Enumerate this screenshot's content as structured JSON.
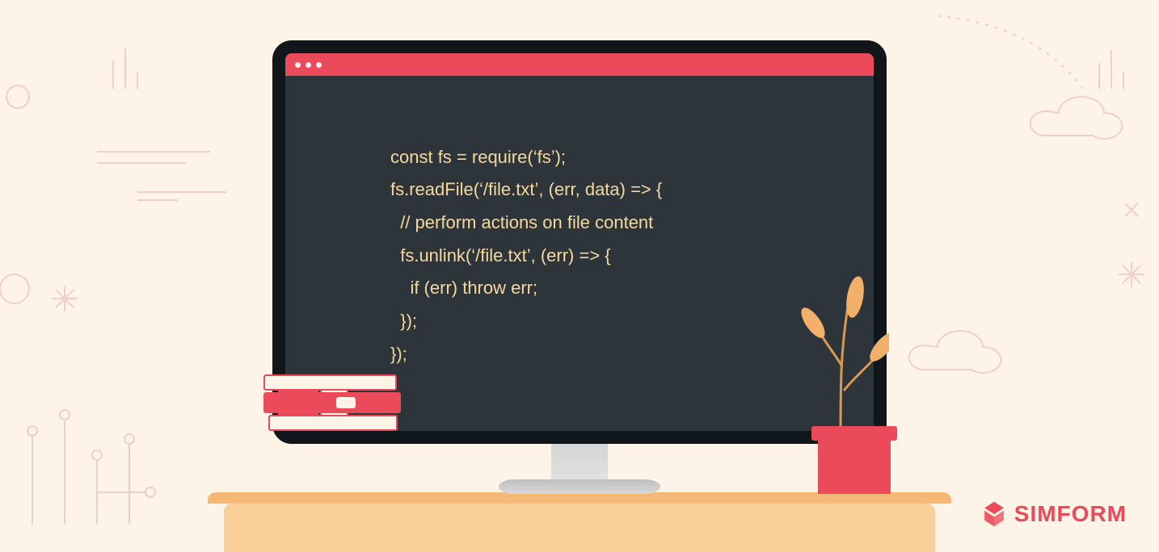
{
  "code": {
    "lines": [
      "const fs = require(‘fs’);",
      "fs.readFile(‘/file.txt’, (err, data) => {",
      "  // perform actions on file content",
      "  fs.unlink(‘/file.txt’, (err) => {",
      "    if (err) throw err;",
      "  });",
      "});"
    ]
  },
  "brand": {
    "name": "SIMFORM"
  },
  "colors": {
    "background": "#fdf3e7",
    "accent": "#ea4a5a",
    "editor_bg": "#2d343a",
    "code_text": "#f5d99e",
    "desk": "#f9cf9a"
  }
}
